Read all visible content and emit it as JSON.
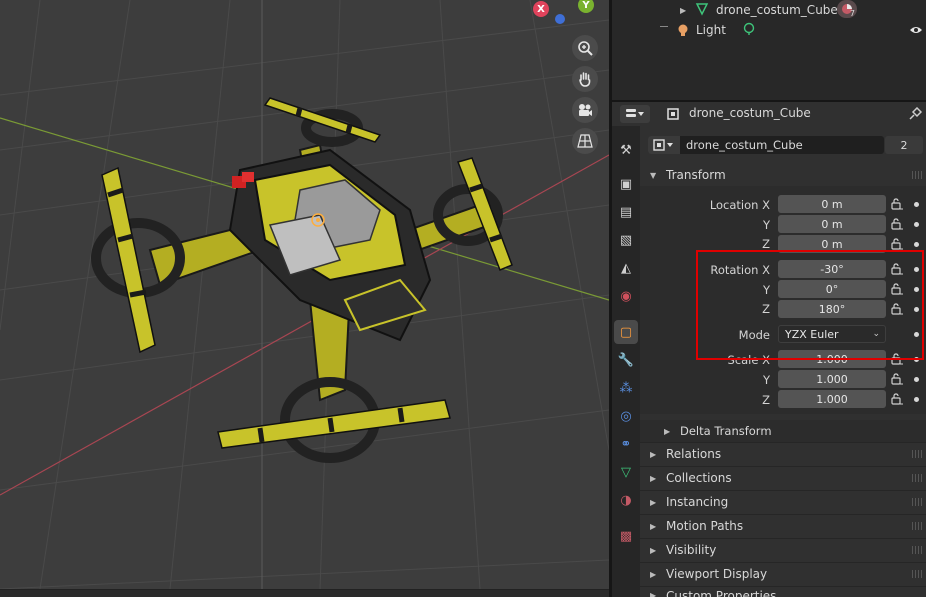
{
  "outliner": {
    "rows": [
      {
        "label": "drone_costum_Cube",
        "badge": "7"
      },
      {
        "label": "Light"
      }
    ]
  },
  "properties": {
    "header_object": "drone_costum_Cube",
    "datablock_name": "drone_costum_Cube",
    "datablock_users": "2",
    "transform": {
      "title": "Transform",
      "location_label": "Location X",
      "rotation_label": "Rotation X",
      "scale_label": "Scale X",
      "y_label": "Y",
      "z_label": "Z",
      "mode_label": "Mode",
      "location": [
        "0 m",
        "0 m",
        "0 m"
      ],
      "rotation": [
        "-30°",
        "0°",
        "180°"
      ],
      "mode_value": "YZX Euler",
      "scale": [
        "1.000",
        "1.000",
        "1.000"
      ]
    },
    "delta_transform": "Delta Transform",
    "panels": [
      "Relations",
      "Collections",
      "Instancing",
      "Motion Paths",
      "Visibility",
      "Viewport Display",
      "Custom Properties"
    ]
  },
  "gizmo": {
    "x_label": "X",
    "y_label": "Y"
  },
  "colors": {
    "highlight": "#e00000",
    "drone_yellow": "#c8c32a",
    "x_axis": "#e0435c",
    "y_axis": "#7ab22f",
    "z_axis": "#3f6fd6",
    "active_tab": "#ff9d3b"
  },
  "icons": [
    "zoom-icon",
    "hand-pan-icon",
    "camera-icon",
    "grid-perspective-icon",
    "tool-icon",
    "render-icon",
    "output-icon",
    "view-layer-icon",
    "scene-icon",
    "world-icon",
    "object-icon",
    "modifier-icon",
    "particles-icon",
    "physics-icon",
    "constraints-icon",
    "data-mesh-icon",
    "material-icon",
    "texture-icon",
    "lock-icon",
    "pin-icon",
    "eye-icon"
  ]
}
